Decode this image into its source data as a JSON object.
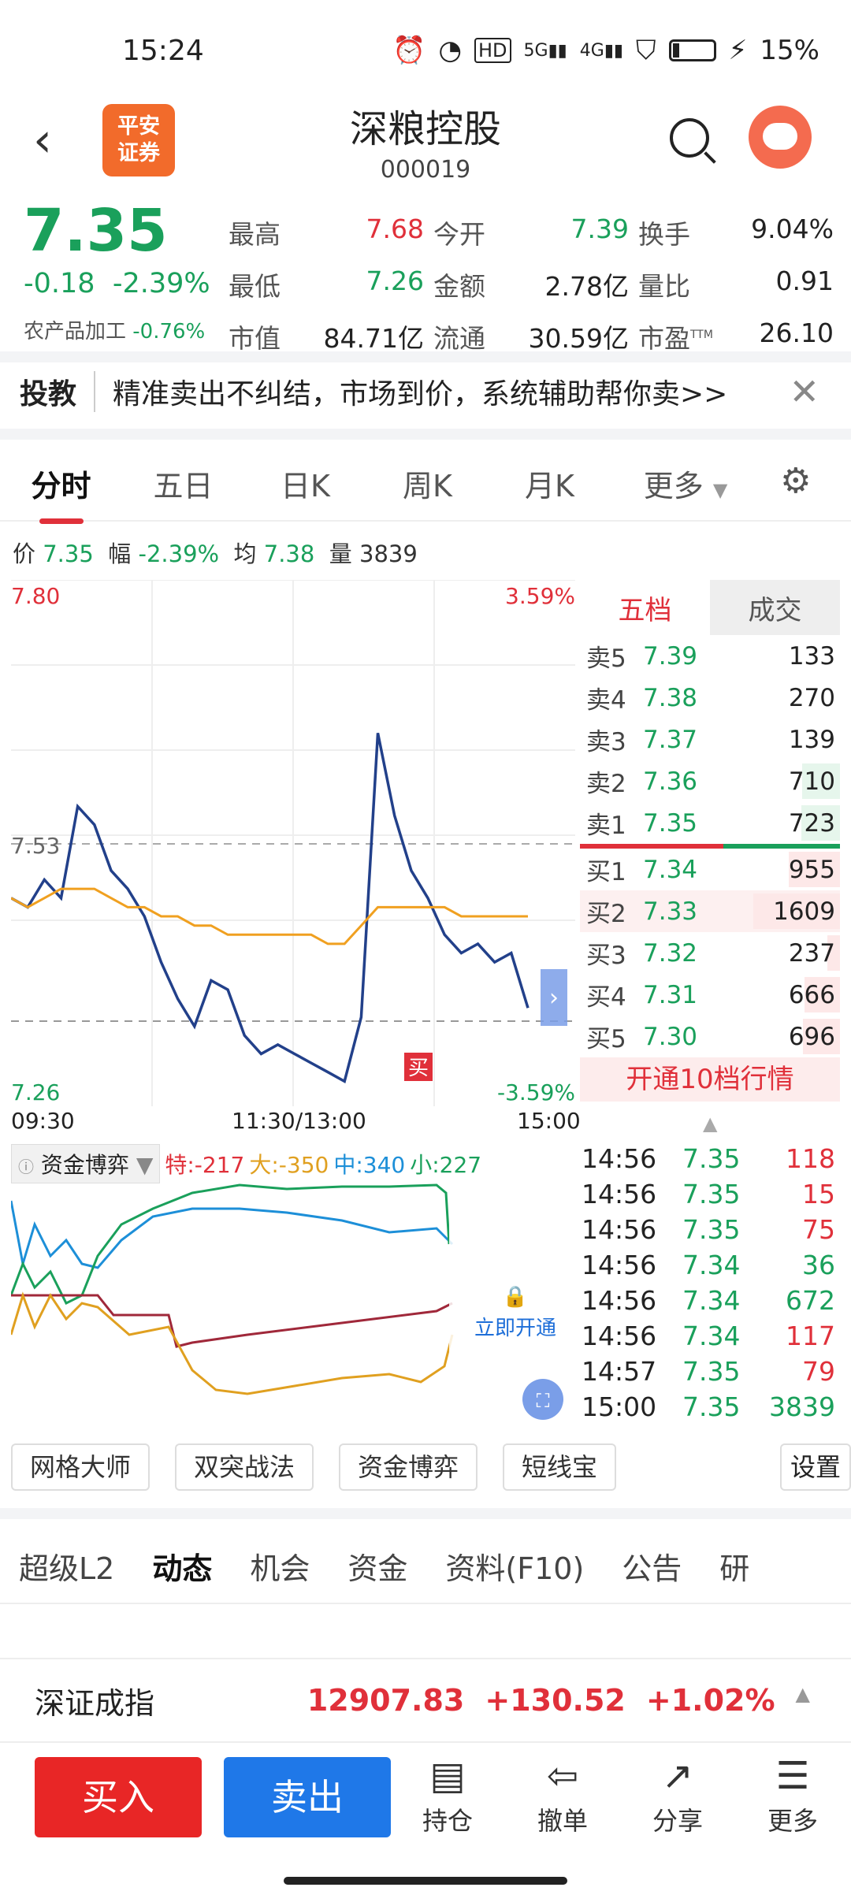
{
  "status": {
    "time": "15:24",
    "battery": "15%",
    "signal_labels": [
      "HD",
      "5G",
      "4G"
    ]
  },
  "header": {
    "logo_line1": "平安",
    "logo_line2": "证券",
    "title": "深粮控股",
    "code": "000019"
  },
  "quote": {
    "price": "7.35",
    "change": "-0.18",
    "change_pct": "-2.39%",
    "industry_label": "农产品加工",
    "industry_pct": "-0.76%",
    "rows": [
      [
        {
          "label": "最高",
          "value": "7.68"
        },
        {
          "label": "今开",
          "value": "7.39"
        },
        {
          "label": "换手",
          "value": "9.04%"
        }
      ],
      [
        {
          "label": "最低",
          "value": "7.26"
        },
        {
          "label": "金额",
          "value": "2.78亿"
        },
        {
          "label": "量比",
          "value": "0.91"
        }
      ],
      [
        {
          "label": "市值",
          "value": "84.71亿"
        },
        {
          "label": "流通",
          "value": "30.59亿"
        },
        {
          "label": "市盈",
          "value": "26.10"
        }
      ]
    ],
    "ttm": "TTM"
  },
  "promo": {
    "tag": "投教",
    "text": "精准卖出不纠结，市场到价，系统辅助帮你卖>>"
  },
  "tabs": [
    "分时",
    "五日",
    "日K",
    "周K",
    "月K",
    "更多"
  ],
  "price_bar": {
    "price_label": "价",
    "price": "7.35",
    "amp_label": "幅",
    "amp": "-2.39%",
    "avg_label": "均",
    "avg": "7.38",
    "vol_label": "量",
    "vol": "3839"
  },
  "chart": {
    "top_price": "7.80",
    "top_pct": "3.59%",
    "mid_price": "7.53",
    "bottom_price": "7.26",
    "bottom_pct": "-3.59%",
    "time_start": "09:30",
    "time_mid": "11:30/13:00",
    "time_end": "15:00",
    "buy_marker": "买"
  },
  "chart_data": {
    "type": "line",
    "ylim": [
      7.26,
      7.8
    ],
    "series": [
      {
        "values": [
          7.47,
          7.46,
          7.49,
          7.47,
          7.57,
          7.55,
          7.5,
          7.48,
          7.45,
          7.4,
          7.36,
          7.33,
          7.38,
          7.37,
          7.32,
          7.3,
          7.31,
          7.3,
          7.29,
          7.28,
          7.27,
          7.34,
          7.65,
          7.56,
          7.5,
          7.47,
          7.43,
          7.41,
          7.42,
          7.4,
          7.41,
          7.35
        ]
      },
      {
        "values": [
          7.47,
          7.46,
          7.47,
          7.48,
          7.48,
          7.48,
          7.47,
          7.46,
          7.46,
          7.45,
          7.45,
          7.44,
          7.44,
          7.43,
          7.43,
          7.43,
          7.43,
          7.43,
          7.43,
          7.42,
          7.42,
          7.44,
          7.46,
          7.46,
          7.46,
          7.46,
          7.46,
          7.45,
          7.45,
          7.45,
          7.45,
          7.45
        ]
      }
    ]
  },
  "book": {
    "tab_five": "五档",
    "tab_trades": "成交",
    "asks": [
      {
        "label": "卖5",
        "price": "7.39",
        "vol": "133",
        "level": 0.0
      },
      {
        "label": "卖4",
        "price": "7.38",
        "vol": "270",
        "level": 0.0
      },
      {
        "label": "卖3",
        "price": "7.37",
        "vol": "139",
        "level": 0.0
      },
      {
        "label": "卖2",
        "price": "7.36",
        "vol": "710",
        "level": 0.44
      },
      {
        "label": "卖1",
        "price": "7.35",
        "vol": "723",
        "level": 0.45
      }
    ],
    "bids": [
      {
        "label": "买1",
        "price": "7.34",
        "vol": "955",
        "level": 0.59
      },
      {
        "label": "买2",
        "price": "7.33",
        "vol": "1609",
        "level": 1.0
      },
      {
        "label": "买3",
        "price": "7.32",
        "vol": "237",
        "level": 0.15
      },
      {
        "label": "买4",
        "price": "7.31",
        "vol": "666",
        "level": 0.41
      },
      {
        "label": "买5",
        "price": "7.30",
        "vol": "696",
        "level": 0.43
      }
    ],
    "open10": "开通10档行情"
  },
  "ticks": [
    {
      "t": "14:56",
      "p": "7.35",
      "v": "118",
      "c": "#e0303a"
    },
    {
      "t": "14:56",
      "p": "7.35",
      "v": "15",
      "c": "#e0303a"
    },
    {
      "t": "14:56",
      "p": "7.35",
      "v": "75",
      "c": "#e0303a"
    },
    {
      "t": "14:56",
      "p": "7.34",
      "v": "36",
      "c": "#1aa05b"
    },
    {
      "t": "14:56",
      "p": "7.34",
      "v": "672",
      "c": "#1aa05b"
    },
    {
      "t": "14:56",
      "p": "7.34",
      "v": "117",
      "c": "#e0303a"
    },
    {
      "t": "14:57",
      "p": "7.35",
      "v": "79",
      "c": "#e0303a"
    },
    {
      "t": "15:00",
      "p": "7.35",
      "v": "3839",
      "c": "#1aa05b"
    }
  ],
  "fund": {
    "name": "资金博弈",
    "te": "特:-217",
    "da": "大:-350",
    "zhong": "中:340",
    "xiao": "小:227",
    "unlock": "立即开通"
  },
  "tools": [
    "网格大师",
    "双突战法",
    "资金博弈",
    "短线宝"
  ],
  "settings_label": "设置",
  "subtabs": [
    "超级L2",
    "动态",
    "机会",
    "资金",
    "资料(F10)",
    "公告",
    "研"
  ],
  "index": {
    "name": "深证成指",
    "value": "12907.83",
    "change": "+130.52",
    "pct": "+1.02%"
  },
  "bottom": {
    "buy": "买入",
    "sell": "卖出",
    "hold": "持仓",
    "cancel": "撤单",
    "share": "分享",
    "more": "更多"
  },
  "colors": {
    "up": "#e0303a",
    "down": "#1aa05b",
    "accent": "#f26b2b",
    "sell_button": "#1f78e8",
    "buy_button": "#e82626"
  }
}
